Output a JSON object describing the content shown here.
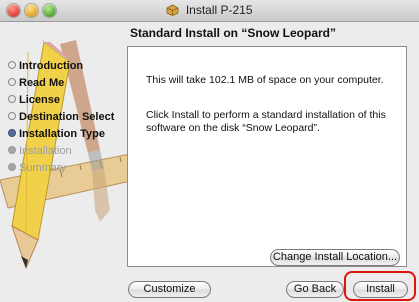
{
  "window": {
    "title": "Install P-215"
  },
  "heading": "Standard Install on “Snow Leopard”",
  "steps": [
    {
      "label": "Introduction",
      "state": "done"
    },
    {
      "label": "Read Me",
      "state": "done"
    },
    {
      "label": "License",
      "state": "done"
    },
    {
      "label": "Destination Select",
      "state": "done"
    },
    {
      "label": "Installation Type",
      "state": "current"
    },
    {
      "label": "Installation",
      "state": "future"
    },
    {
      "label": "Summary",
      "state": "future"
    }
  ],
  "content": {
    "paragraph1": "This will take 102.1 MB of space on your computer.",
    "paragraph2": "Click Install to perform a standard installation of this software on the disk “Snow Leopard”."
  },
  "buttons": {
    "change_location": "Change Install Location...",
    "customize": "Customize",
    "go_back": "Go Back",
    "install": "Install"
  },
  "colors": {
    "highlight": "#e0140f",
    "current_step_bullet": "#5a6e9a"
  },
  "icons": {
    "title": "package-installer-icon",
    "art": "pencil-ruler-brush-artwork"
  }
}
